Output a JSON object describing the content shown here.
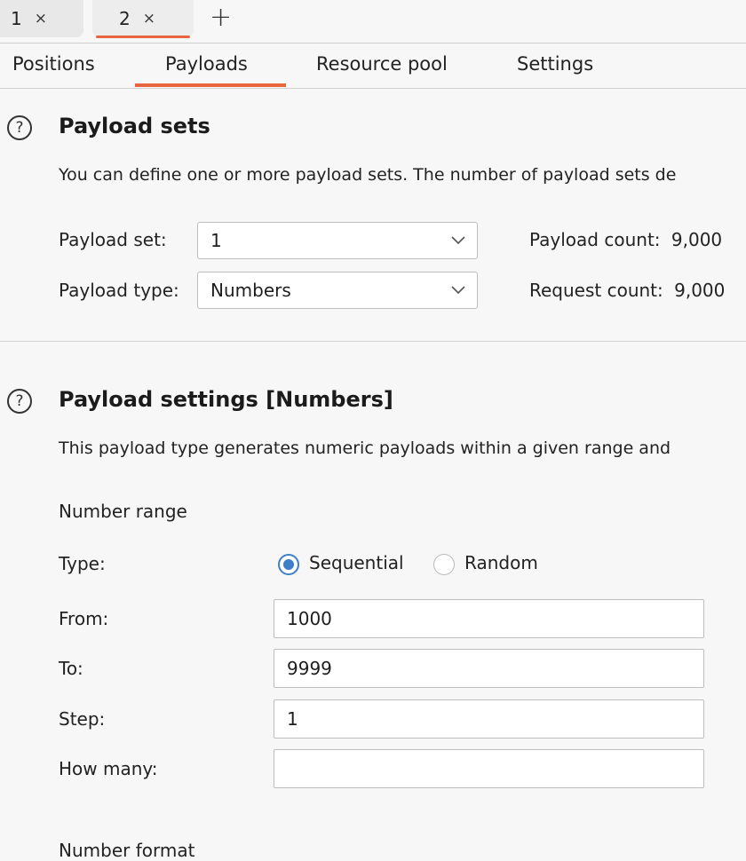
{
  "request_tabs": [
    {
      "label": "1",
      "close": "×"
    },
    {
      "label": "2",
      "close": "×"
    }
  ],
  "new_tab_label": "+",
  "sub_tabs": [
    "Positions",
    "Payloads",
    "Resource pool",
    "Settings"
  ],
  "active_sub_tab": "Payloads",
  "payload_sets": {
    "help": "?",
    "title": "Payload sets",
    "description": "You can define one or more payload sets. The number of payload sets de",
    "set_label": "Payload set:",
    "set_value": "1",
    "type_label": "Payload type:",
    "type_value": "Numbers",
    "payload_count_label": "Payload count:",
    "payload_count": "9,000",
    "request_count_label": "Request count:",
    "request_count": "9,000"
  },
  "payload_settings": {
    "help": "?",
    "title": "Payload settings [Numbers]",
    "description": "This payload type generates numeric payloads within a given range and",
    "number_range_heading": "Number range",
    "type_label": "Type:",
    "type_options": [
      "Sequential",
      "Random"
    ],
    "type_selected": "Sequential",
    "from_label": "From:",
    "from_value": "1000",
    "to_label": "To:",
    "to_value": "9999",
    "step_label": "Step:",
    "step_value": "1",
    "how_many_label": "How many:",
    "how_many_value": "",
    "number_format_heading": "Number format"
  },
  "colors": {
    "accent": "#e8663d",
    "radio_selected": "#3d7fc9"
  }
}
